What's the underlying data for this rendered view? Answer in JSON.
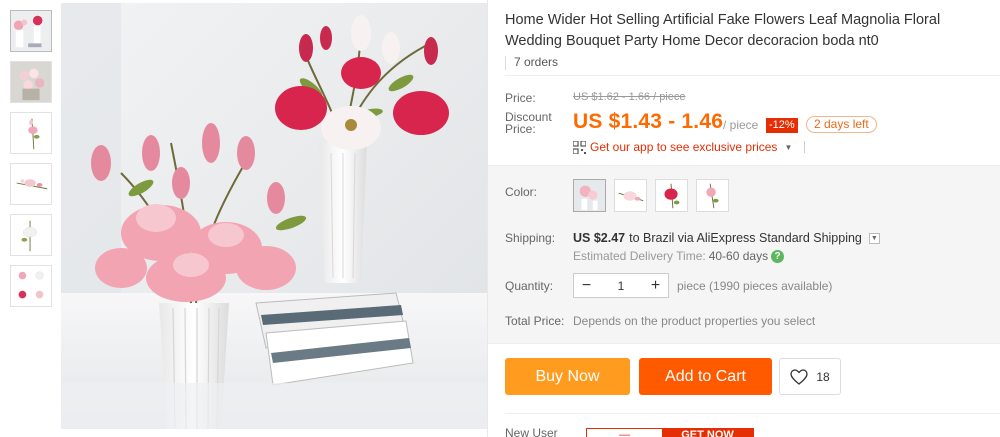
{
  "product": {
    "title": "Home Wider Hot Selling Artificial Fake Flowers Leaf Magnolia Floral Wedding Bouquet Party Home Decor decoracion boda nt0",
    "orders": "7 orders"
  },
  "gallery": {
    "thumbnails": [
      "thumb-1",
      "thumb-2",
      "thumb-3",
      "thumb-4",
      "thumb-5",
      "thumb-6"
    ],
    "active_index": 0
  },
  "pricing": {
    "price_label": "Price:",
    "original_price": "US $1.62 - 1.66 / piece",
    "discount_label": "Discount Price:",
    "discount_price": "US $1.43 - 1.46",
    "per_piece": "/ piece",
    "discount_badge": "-12%",
    "time_left": "2 days left",
    "app_promo": "Get our app to see exclusive prices",
    "app_promo_caret": "▼"
  },
  "sku": {
    "color_label": "Color:",
    "colors": [
      "light-pink",
      "pink-white",
      "rose-red",
      "pink"
    ],
    "selected_color_index": 0,
    "shipping_label": "Shipping:",
    "shipping_cost": "US $2.47",
    "shipping_rest": "to Brazil via AliExpress Standard Shipping",
    "shipping_dd": "▼",
    "estimated_label": "Estimated Delivery Time:",
    "estimated_days": "40-60 days",
    "help_glyph": "?",
    "quantity_label": "Quantity:",
    "quantity_minus": "−",
    "quantity_value": "1",
    "quantity_plus": "+",
    "quantity_note": "piece (1990 pieces available)",
    "total_label": "Total Price:",
    "total_note": "Depends on the product properties you select"
  },
  "actions": {
    "buy_now": "Buy Now",
    "add_to_cart": "Add to Cart",
    "wishlist_count": "18"
  },
  "footer": {
    "new_user_label": "New User",
    "coupon_left": "—",
    "coupon_right": "GET NOW"
  },
  "colors": {
    "accent_orange": "#ff6a00",
    "buy_now_bg": "#ff9b1e",
    "add_to_cart_bg": "#ff5a00",
    "discount_red": "#e62e04"
  }
}
